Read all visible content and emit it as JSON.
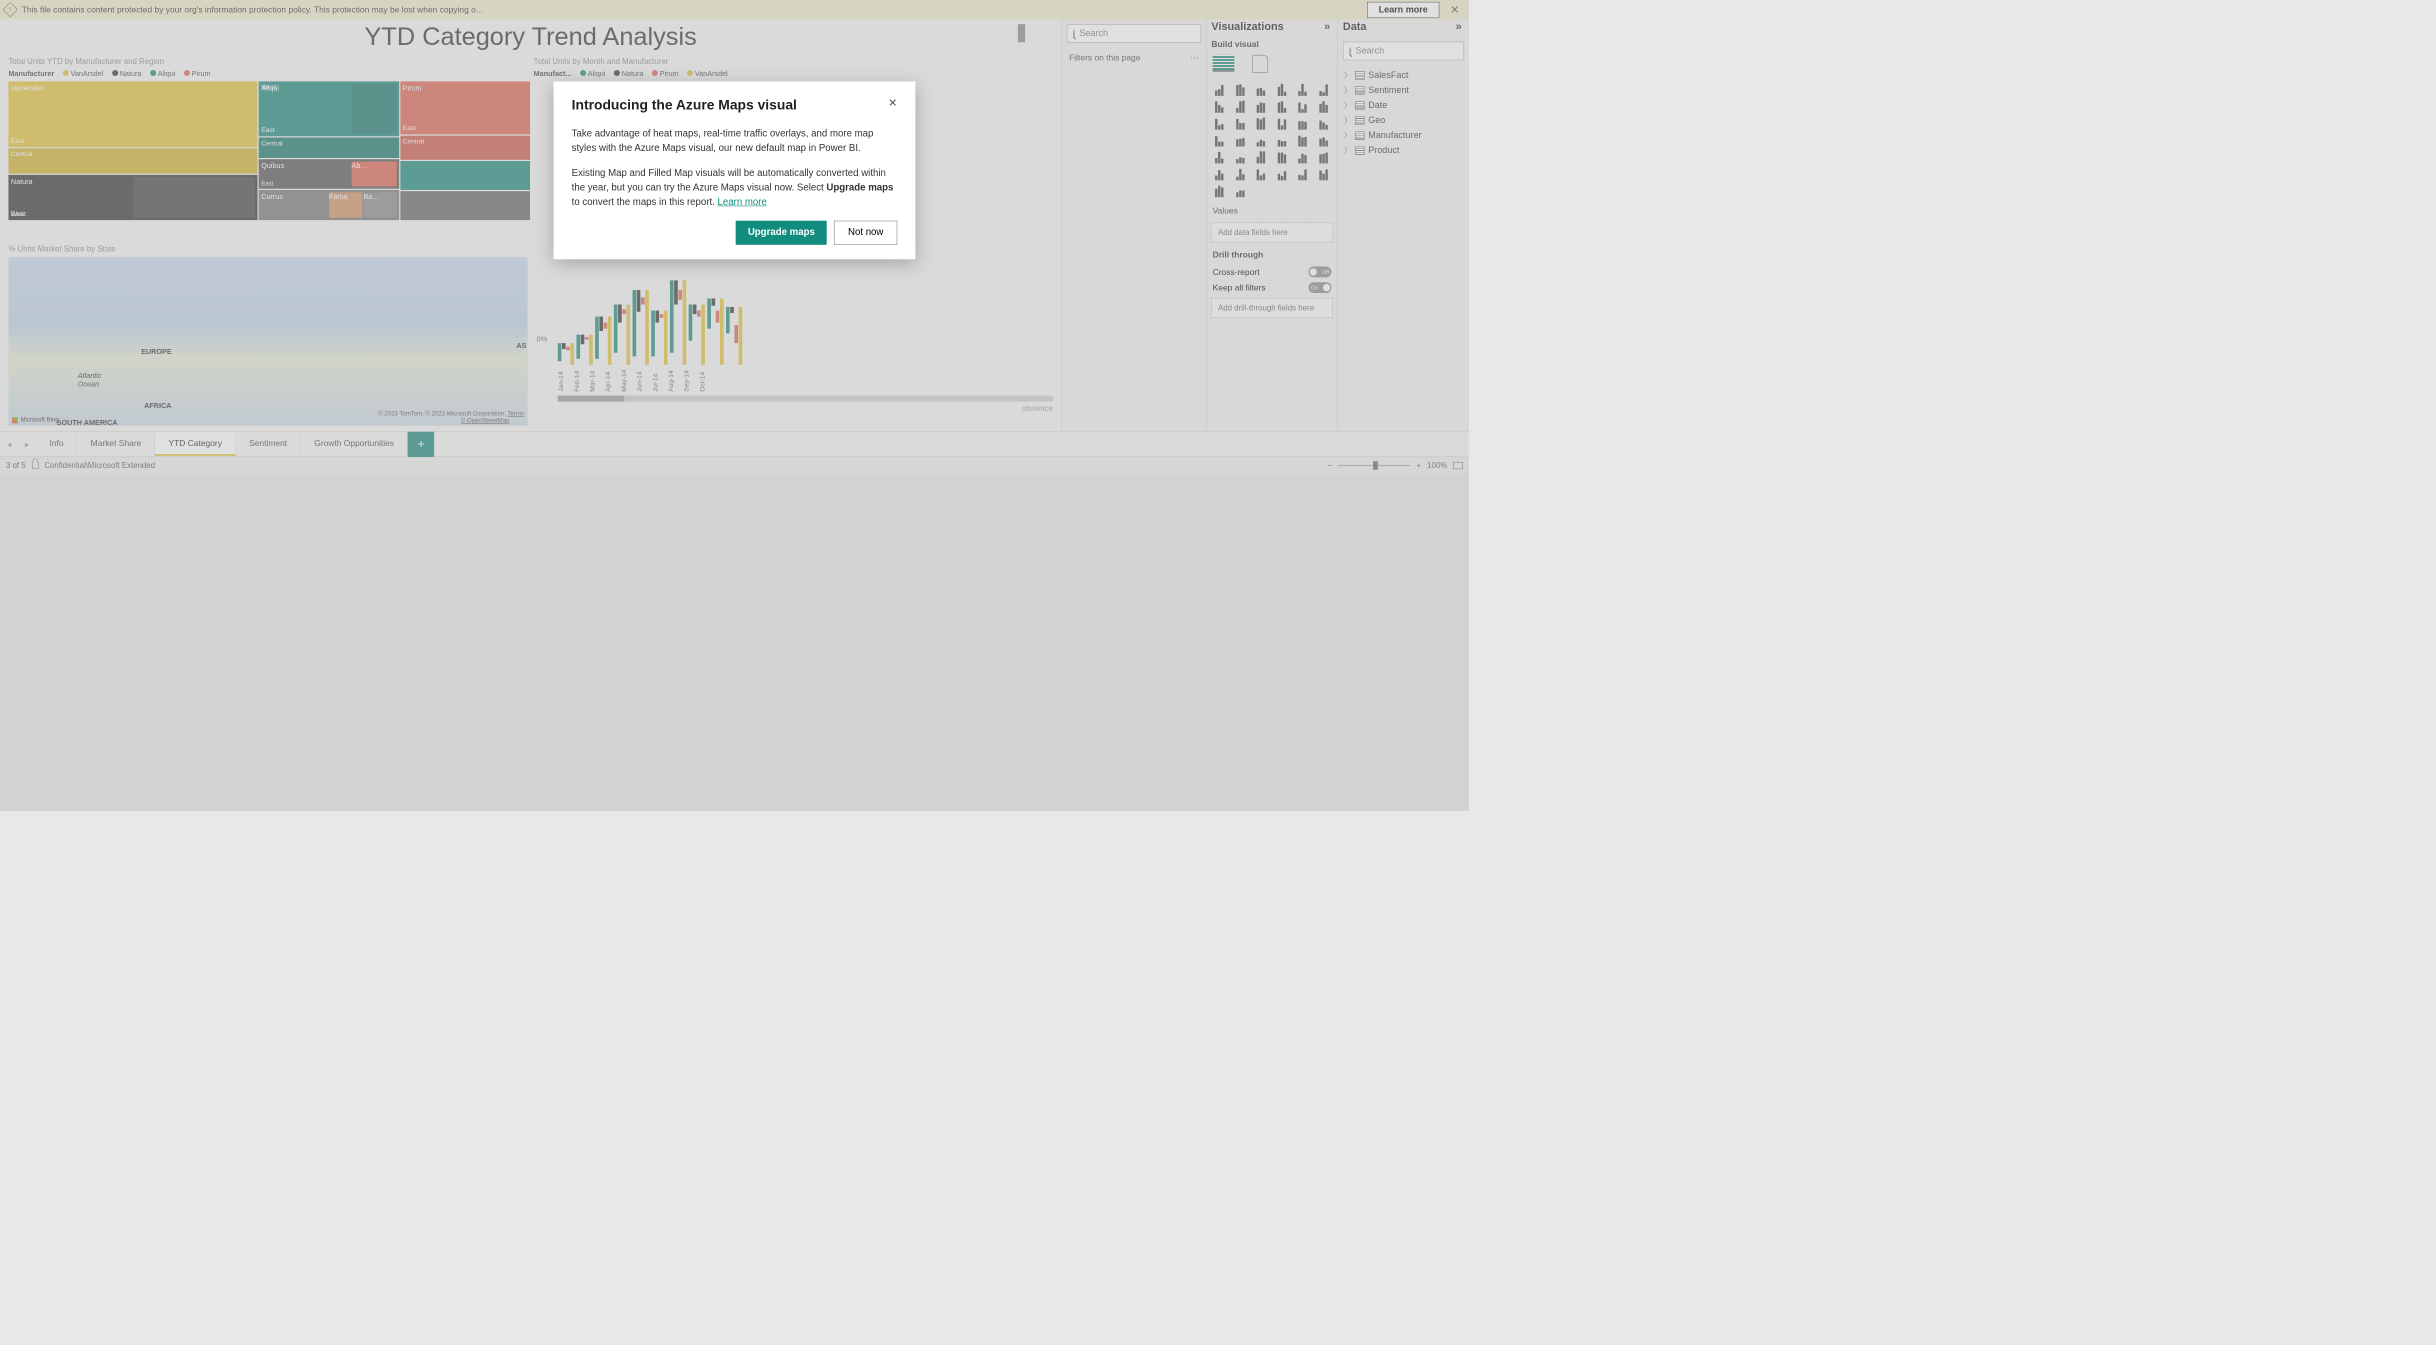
{
  "banner": {
    "text": "This file contains content protected by your org's information protection policy. This protection may be lost when copying o...",
    "learn_more": "Learn more"
  },
  "report": {
    "title": "YTD Category Trend Analysis",
    "treemap_title": "Total Units YTD by Manufacturer and Region",
    "legend_label": "Manufacturer",
    "legend_items": [
      "VanArsdel",
      "Natura",
      "Aliqui",
      "Pirum"
    ],
    "treemap_cells": {
      "vanarsdel": "VanArsdel",
      "east": "East",
      "central": "Central",
      "natura": "Natura",
      "west": "West",
      "aliqui": "Aliqui",
      "quibus": "Quibus",
      "ab": "Ab...",
      "currus": "Currus",
      "fama": "Fama",
      "ba": "Ba...",
      "pirum": "Pirum"
    },
    "colchart_title": "Total Units by Month and Manufacturer",
    "colchart_legend_label": "Manufact...",
    "colchart_legend": [
      "Aliqui",
      "Natura",
      "Pirum",
      "VanArsdel"
    ],
    "colchart_zero": "0%",
    "months": [
      "Jan-14",
      "Feb-14",
      "Mar-14",
      "Apr-14",
      "May-14",
      "Jun-14",
      "Jul-14",
      "Aug-14",
      "Sep-14",
      "Oct-14"
    ],
    "map_title": "% Units Market Share by State",
    "map_labels": {
      "europe": "EUROPE",
      "africa": "AFRICA",
      "south_america": "SOUTH AMERICA",
      "atlantic": "Atlantic\nOcean",
      "as": "AS"
    },
    "map_attrib": "© 2023 TomTom, © 2023 Microsoft Corporation,",
    "map_terms": "Terms",
    "map_osm": "© OpenStreetMap",
    "map_bing": "Microsoft Bing",
    "obvience": "obvience"
  },
  "filters": {
    "search_placeholder": "Search",
    "header": "Filters on this page"
  },
  "viz": {
    "title": "Visualizations",
    "build": "Build visual",
    "values": "Values",
    "add_fields": "Add data fields here",
    "drill": "Drill through",
    "cross": "Cross-report",
    "cross_state": "Off",
    "keep": "Keep all filters",
    "keep_state": "On",
    "add_drill": "Add drill-through fields here"
  },
  "data": {
    "title": "Data",
    "search_placeholder": "Search",
    "tables": [
      "SalesFact",
      "Sentiment",
      "Date",
      "Geo",
      "Manufacturer",
      "Product"
    ]
  },
  "tabs": [
    "Info",
    "Market Share",
    "YTD Category",
    "Sentiment",
    "Growth Opportunities"
  ],
  "active_tab": 2,
  "status": {
    "page": "3 of 5",
    "sensitivity": "Confidential\\Microsoft Extended",
    "zoom": "100%"
  },
  "dialog": {
    "title": "Introducing the Azure Maps visual",
    "p1": "Take advantage of heat maps, real-time traffic overlays, and more map styles with the Azure Maps visual, our new default map in Power BI.",
    "p2a": "Existing Map and Filled Map visuals will be automatically converted within the year, but you can try the Azure Maps visual now. Select ",
    "p2b": "Upgrade maps",
    "p2c": " to convert the maps in this report. ",
    "learn": "Learn more",
    "primary": "Upgrade maps",
    "secondary": "Not now"
  },
  "chart_data": {
    "type": "bar",
    "title": "Total Units by Month and Manufacturer",
    "categories": [
      "Jan-14",
      "Feb-14",
      "Mar-14",
      "Apr-14",
      "May-14",
      "Jun-14",
      "Jul-14",
      "Aug-14",
      "Sep-14",
      "Oct-14"
    ],
    "series": [
      {
        "name": "Aliqui",
        "values": [
          15,
          20,
          35,
          40,
          55,
          38,
          60,
          30,
          25,
          22
        ]
      },
      {
        "name": "Natura",
        "values": [
          5,
          8,
          12,
          15,
          18,
          10,
          20,
          8,
          6,
          5
        ]
      },
      {
        "name": "Pirum",
        "values": [
          -3,
          -2,
          -5,
          -4,
          -6,
          -3,
          -8,
          -5,
          -10,
          -15
        ]
      },
      {
        "name": "VanArsdel",
        "values": [
          18,
          25,
          40,
          50,
          62,
          45,
          70,
          50,
          55,
          48
        ]
      }
    ],
    "ylabel": "%",
    "ylim": [
      -20,
      80
    ]
  }
}
